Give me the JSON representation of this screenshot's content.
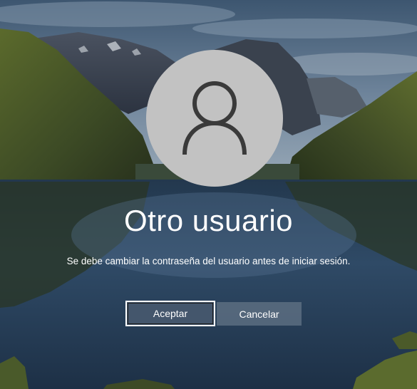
{
  "login": {
    "username": "Otro usuario",
    "message": "Se debe cambiar la contraseña del usuario antes de iniciar sesión.",
    "avatar_icon": "user-icon"
  },
  "buttons": {
    "ok_label": "Aceptar",
    "cancel_label": "Cancelar"
  },
  "colors": {
    "avatar_bg": "#c2c2c2",
    "avatar_icon": "#3a3a3a",
    "text": "#ffffff",
    "button_bg": "#46586e"
  }
}
